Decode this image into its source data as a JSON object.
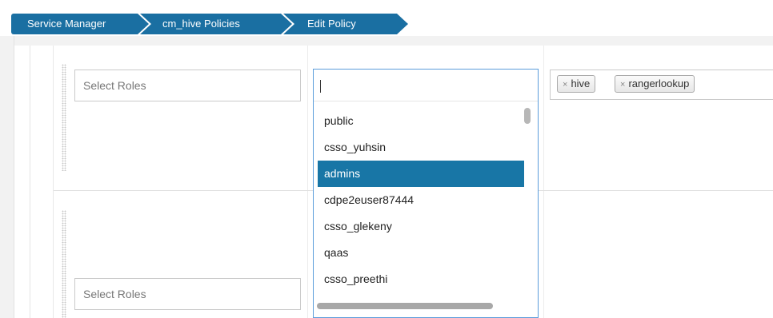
{
  "breadcrumb": {
    "items": [
      {
        "label": "Service Manager"
      },
      {
        "label": "cm_hive Policies"
      },
      {
        "label": "Edit Policy"
      }
    ]
  },
  "row1": {
    "roles_placeholder": "Select Roles",
    "search_value": "",
    "selected_users": [
      "hive",
      "rangerlookup"
    ],
    "tag_remove_glyph": "×"
  },
  "row2": {
    "roles_placeholder": "Select Roles"
  },
  "dropdown": {
    "options": [
      "public",
      "csso_yuhsin",
      "admins",
      "cdpe2euser87444",
      "csso_glekeny",
      "qaas",
      "csso_preethi"
    ],
    "highlighted": "admins"
  },
  "colors": {
    "breadcrumb_bg": "#1a6fa2",
    "highlight_bg": "#1876a6",
    "focus_border": "#5b9ddb"
  },
  "icons": {
    "tag_remove": "close-icon",
    "drag": "drag-handle-icon"
  }
}
